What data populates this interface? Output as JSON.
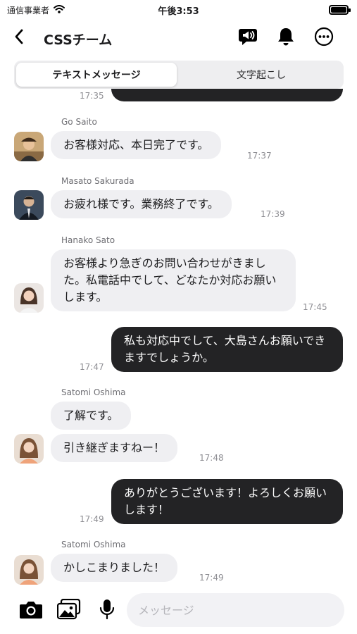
{
  "status_bar": {
    "carrier": "通信事業者",
    "time": "午後3:53",
    "battery_level": 1.0
  },
  "header": {
    "title": "CSSチーム",
    "icons": [
      "back-chevron-icon",
      "megaphone-icon",
      "bell-icon",
      "more-icon"
    ]
  },
  "tabs": [
    {
      "label": "テキストメッセージ",
      "active": true
    },
    {
      "label": "文字起こし",
      "active": false
    }
  ],
  "messages": [
    {
      "id": "m0",
      "direction": "out",
      "time": "17:35",
      "text": ""
    },
    {
      "id": "m1",
      "direction": "in",
      "sender": "Go Saito",
      "text": "お客様対応、本日完了です。",
      "time": "17:37"
    },
    {
      "id": "m2",
      "direction": "in",
      "sender": "Masato Sakurada",
      "text": "お疲れ様です。業務終了です。",
      "time": "17:39"
    },
    {
      "id": "m3",
      "direction": "in",
      "sender": "Hanako Sato",
      "text": "お客様より急ぎのお問い合わせがきました。私電話中でして、どなたか対応お願いします。",
      "time": "17:45"
    },
    {
      "id": "m4",
      "direction": "out",
      "text": "私も対応中でして、大島さんお願いできますでしょうか。",
      "time": "17:47"
    },
    {
      "id": "m5",
      "direction": "in",
      "sender": "Satomi Oshima",
      "text": "了解です。",
      "time": ""
    },
    {
      "id": "m6",
      "direction": "in",
      "text": "引き継ぎますねー！",
      "time": "17:48"
    },
    {
      "id": "m7",
      "direction": "out",
      "text": "ありがとうございます！よろしくお願いします！",
      "time": "17:49"
    },
    {
      "id": "m8",
      "direction": "in",
      "sender": "Satomi Oshima",
      "text": "かしこまりました！",
      "time": "17:49"
    }
  ],
  "input_bar": {
    "placeholder": "メッセージ",
    "value": "",
    "icons": [
      "camera-icon",
      "photo-library-icon",
      "microphone-icon"
    ]
  },
  "colors": {
    "outgoing_bubble": "#232325",
    "incoming_bubble": "#efeff2",
    "text_secondary": "#8e8e93"
  }
}
